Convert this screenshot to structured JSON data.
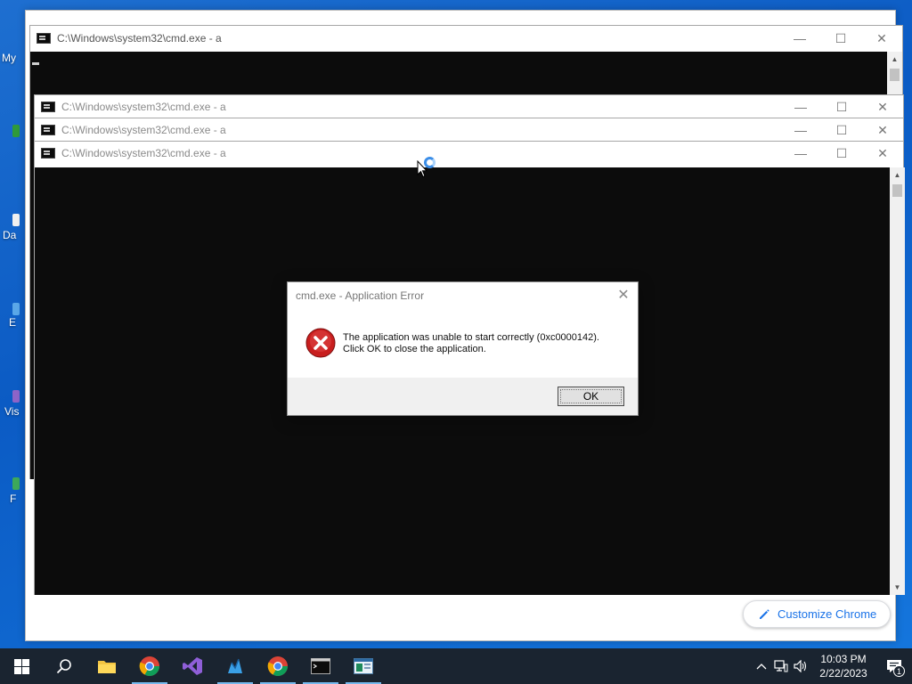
{
  "desktop": {
    "fragments": [
      "My",
      "Da",
      "E",
      "Vis",
      "F"
    ]
  },
  "chrome": {
    "customize_label": "Customize Chrome"
  },
  "cmd_windows": [
    {
      "title": "C:\\Windows\\system32\\cmd.exe - a"
    },
    {
      "title": "C:\\Windows\\system32\\cmd.exe - a"
    },
    {
      "title": "C:\\Windows\\system32\\cmd.exe - a"
    },
    {
      "title": "C:\\Windows\\system32\\cmd.exe - a"
    }
  ],
  "titlebar_buttons": {
    "minimize": "—",
    "maximize": "☐",
    "close": "✕"
  },
  "dialog": {
    "title": "cmd.exe - Application Error",
    "line1": "The application was unable to start correctly (0xc0000142).",
    "line2": "Click OK to close the application.",
    "ok_label": "OK",
    "close_glyph": "✕",
    "icon": "error-x-icon"
  },
  "taskbar": {
    "items": [
      "start-icon",
      "search-icon",
      "file-explorer-icon",
      "chrome-icon",
      "visual-studio-icon",
      "network-tool-icon",
      "chrome-icon",
      "cmd-icon",
      "app-window-icon"
    ],
    "tray": {
      "chevron": "^",
      "time": "10:03 PM",
      "date": "2/22/2023",
      "notification_count": "1"
    }
  },
  "colors": {
    "accent": "#1a73e8",
    "taskbar": "#1a2430",
    "console": "#0c0c0c",
    "error": "#c81e1e"
  }
}
